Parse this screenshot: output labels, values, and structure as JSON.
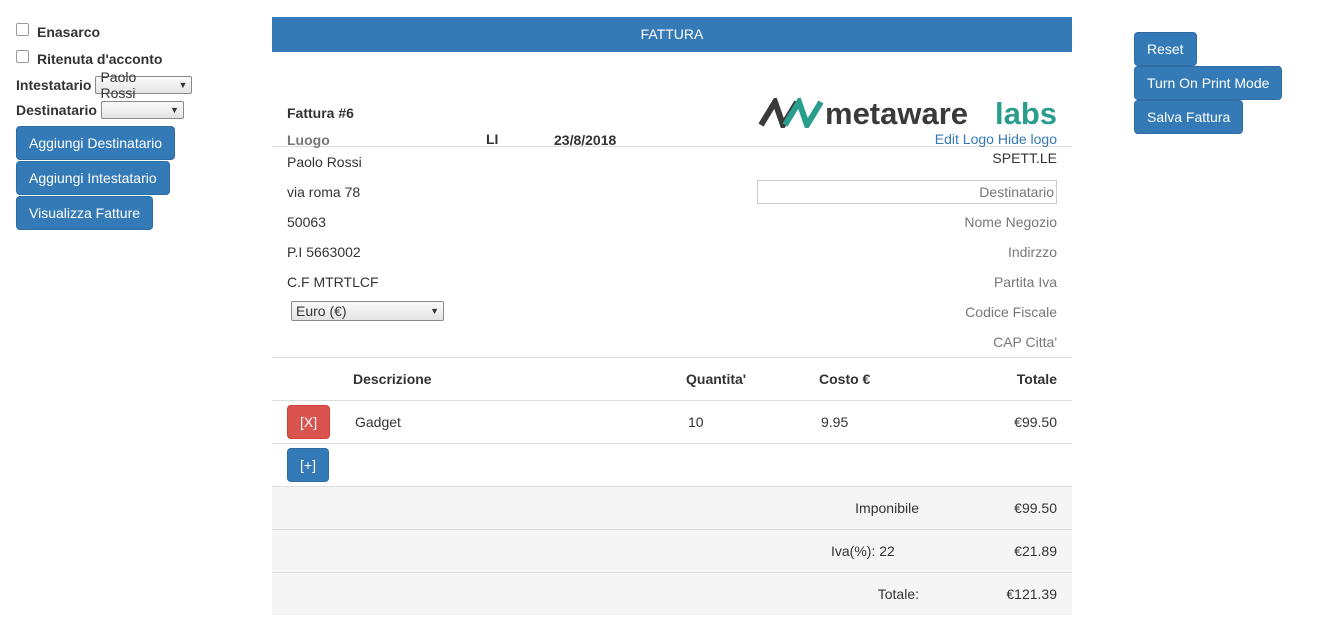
{
  "left": {
    "enasarco_label": "Enasarco",
    "ritenuta_label": "Ritenuta d'acconto",
    "intestatario_label": "Intestatario",
    "intestatario_value": "Paolo Rossi",
    "destinatario_label": "Destinatario",
    "destinatario_value": "",
    "btn_add_dest": "Aggiungi Destinatario",
    "btn_add_int": "Aggiungi Intestatario",
    "btn_view": "Visualizza Fatture"
  },
  "right": {
    "reset": "Reset",
    "print_mode": "Turn On Print Mode",
    "save": "Salva Fattura"
  },
  "invoice": {
    "header": "FATTURA",
    "number": "Fattura #6",
    "luogo": "Luogo",
    "province": "LI",
    "date": "23/8/2018",
    "logo_word1": "metaware",
    "logo_word2": "labs",
    "edit_logo": "Edit Logo",
    "hide_logo": "Hide logo",
    "sender": {
      "name": "Paolo Rossi",
      "street": "via roma 78",
      "cap": "50063",
      "piva": "P.I 5663002",
      "cf": "C.F MTRTLCF"
    },
    "currency": "Euro (€)",
    "recipient": {
      "spett": "SPETT.LE",
      "dest_placeholder": "Destinatario",
      "negozio": "Nome Negozio",
      "indirizzo": "Indirzzo",
      "partita_iva": "Partita Iva",
      "codice_fiscale": "Codice Fiscale",
      "cap_citta": "CAP Citta'"
    },
    "columns": {
      "descrizione": "Descrizione",
      "quantita": "Quantita'",
      "costo": "Costo €",
      "totale": "Totale"
    },
    "items": [
      {
        "remove": "[X]",
        "description": "Gadget",
        "qty": "10",
        "cost": "9.95",
        "total": "€99.50"
      }
    ],
    "add_row": "[+]",
    "summary": {
      "imponibile_label": "Imponibile",
      "imponibile": "€99.50",
      "iva_label": "Iva(%):",
      "iva_rate": "22",
      "iva": "€21.89",
      "totale_label": "Totale:",
      "totale": "€121.39"
    }
  },
  "colors": {
    "primary": "#337ab7",
    "danger": "#d9534f",
    "logo_dark": "#3a3a3a",
    "logo_teal": "#2a9d8f"
  }
}
